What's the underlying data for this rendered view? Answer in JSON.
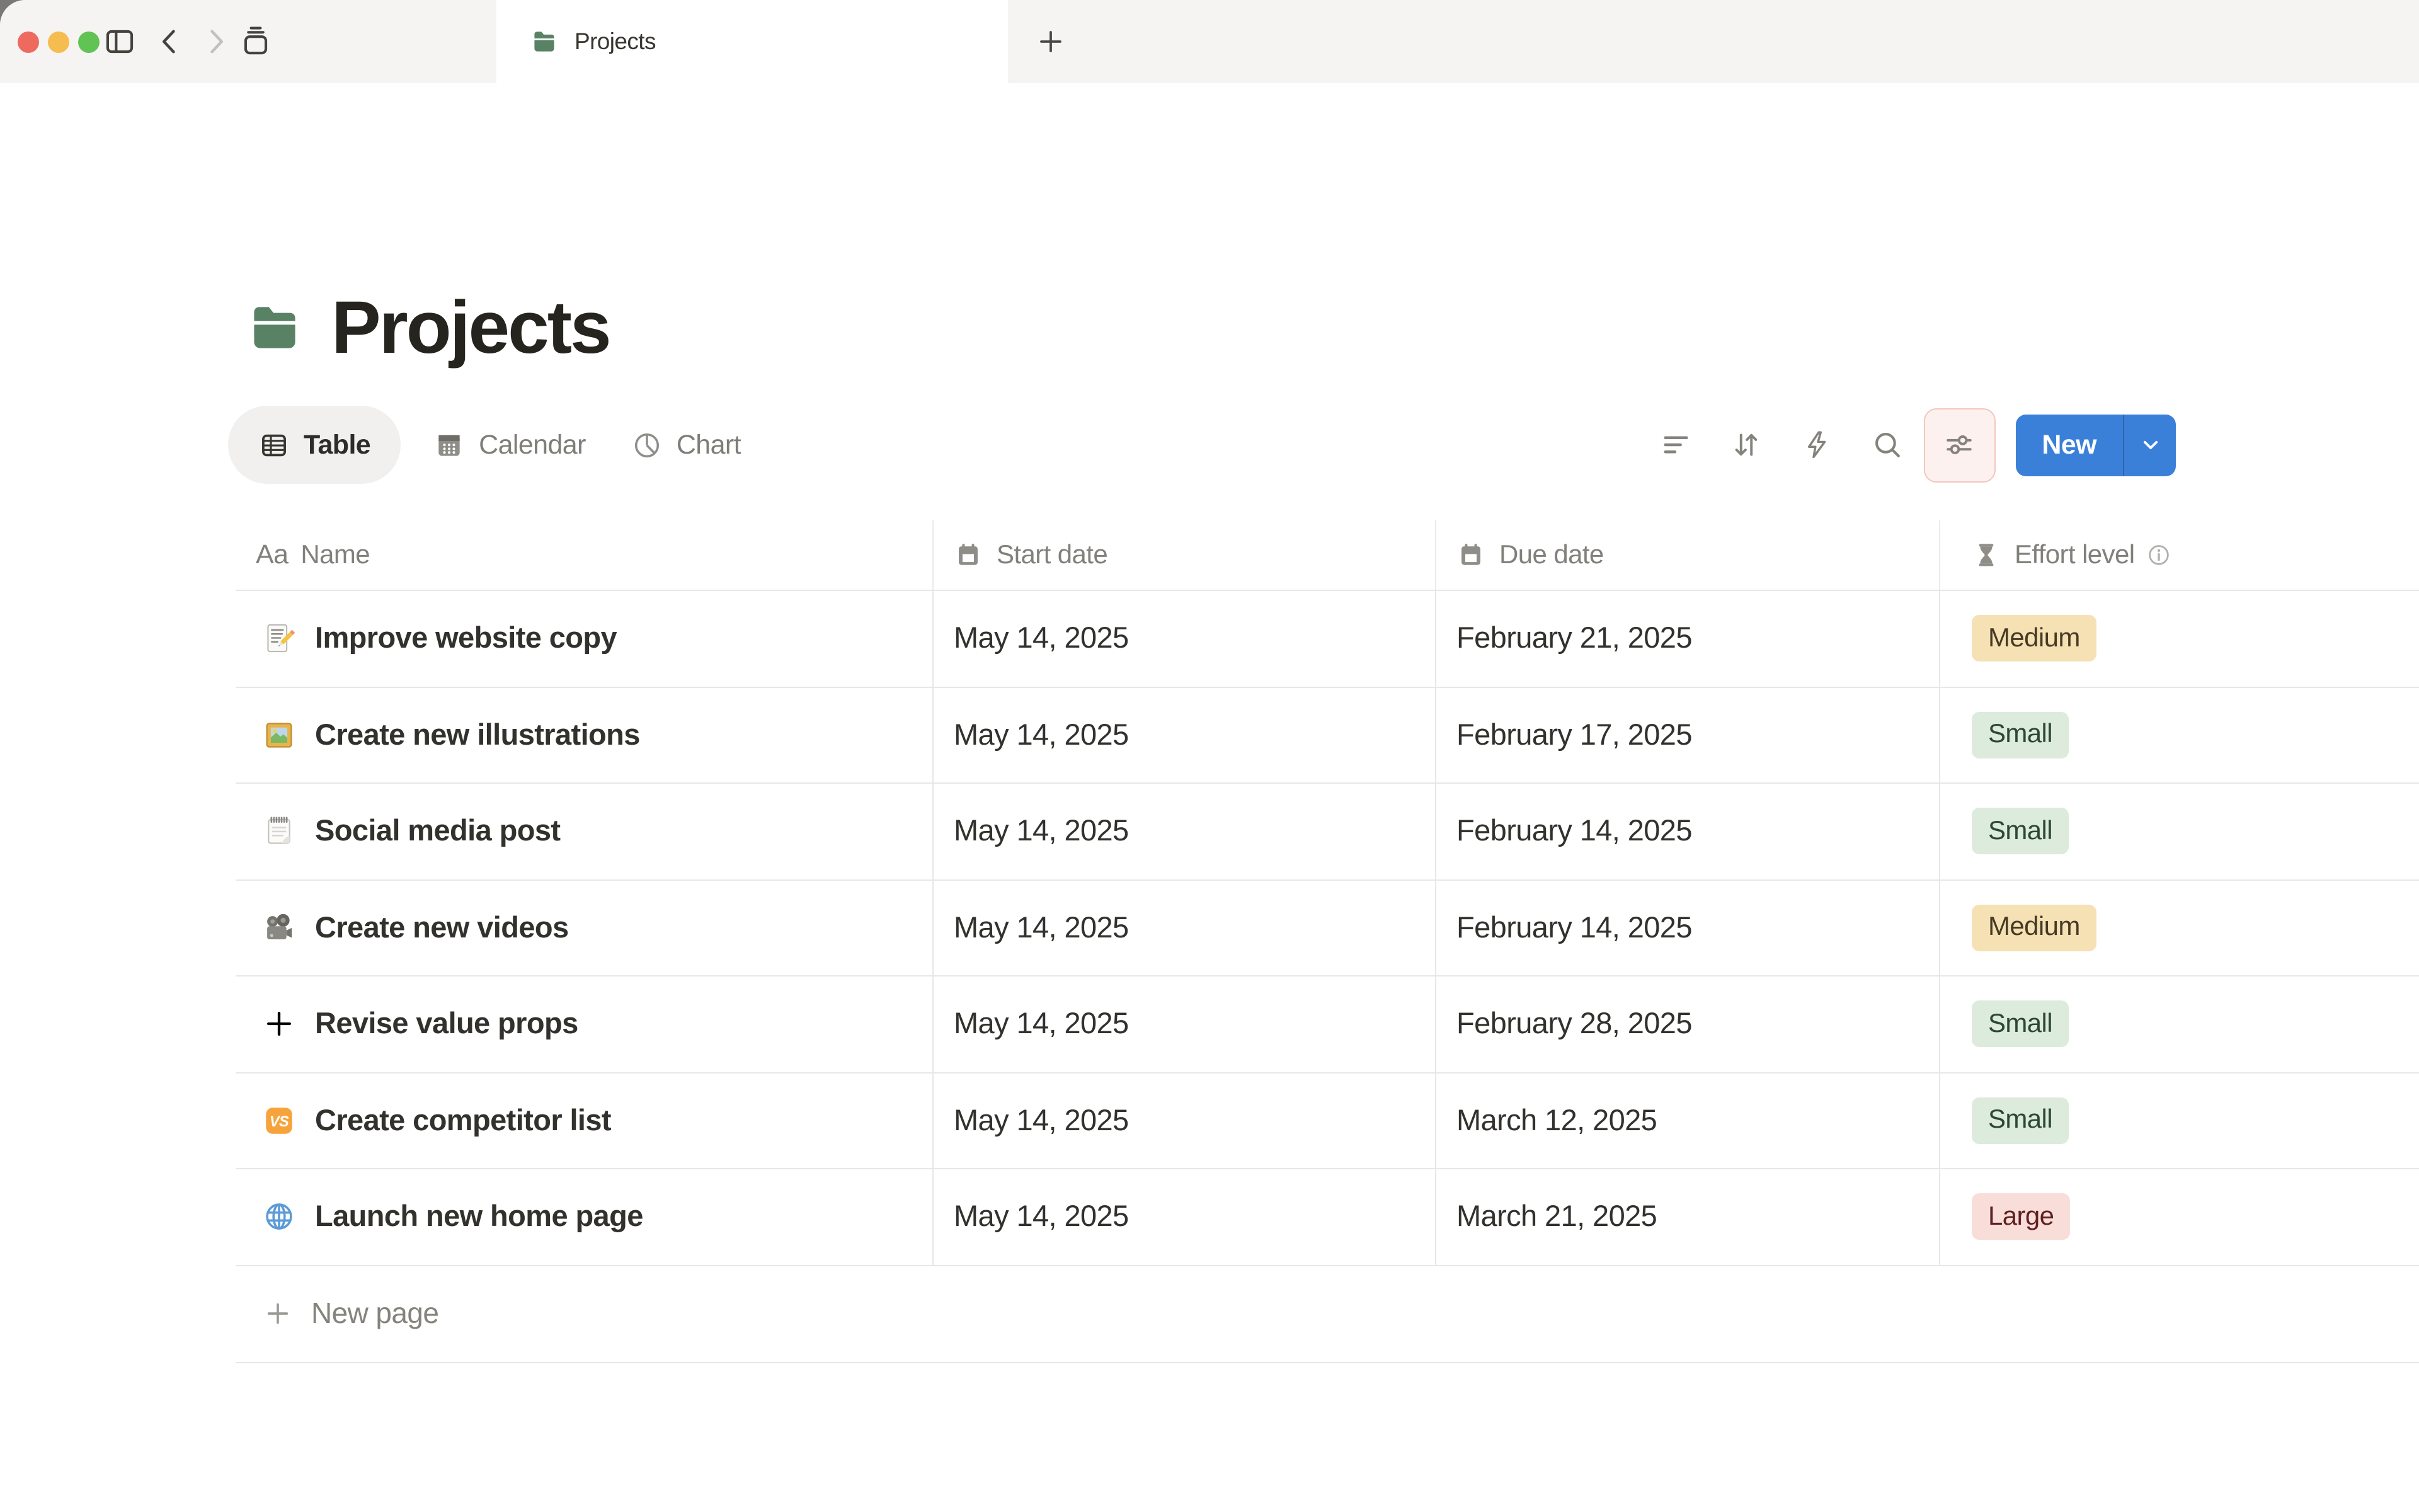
{
  "window": {
    "tab_title": "Projects"
  },
  "page": {
    "title": "Projects",
    "icon": "folder"
  },
  "views": [
    {
      "label": "Table",
      "icon": "table",
      "active": true
    },
    {
      "label": "Calendar",
      "icon": "calendar",
      "active": false
    },
    {
      "label": "Chart",
      "icon": "chart",
      "active": false
    }
  ],
  "toolbar": {
    "new_label": "New",
    "icons": [
      "filter",
      "sort",
      "automations",
      "search",
      "view-settings"
    ]
  },
  "table": {
    "columns": [
      {
        "label": "Name",
        "icon": "text",
        "icon_glyph": "Aa"
      },
      {
        "label": "Start date",
        "icon": "calendar"
      },
      {
        "label": "Due date",
        "icon": "calendar"
      },
      {
        "label": "Effort level",
        "icon": "hourglass",
        "info": true
      }
    ],
    "rows": [
      {
        "icon": "memo",
        "name": "Improve website copy",
        "start_date": "May 14, 2025",
        "due_date": "February 21, 2025",
        "effort": {
          "label": "Medium",
          "color": "yellow"
        }
      },
      {
        "icon": "frame",
        "name": "Create new illustrations",
        "start_date": "May 14, 2025",
        "due_date": "February 17, 2025",
        "effort": {
          "label": "Small",
          "color": "green"
        }
      },
      {
        "icon": "notepad",
        "name": "Social media post",
        "start_date": "May 14, 2025",
        "due_date": "February 14, 2025",
        "effort": {
          "label": "Small",
          "color": "green"
        }
      },
      {
        "icon": "camera",
        "name": "Create new videos",
        "start_date": "May 14, 2025",
        "due_date": "February 14, 2025",
        "effort": {
          "label": "Medium",
          "color": "yellow"
        }
      },
      {
        "icon": "plus",
        "name": "Revise value props",
        "start_date": "May 14, 2025",
        "due_date": "February 28, 2025",
        "effort": {
          "label": "Small",
          "color": "green"
        }
      },
      {
        "icon": "vs",
        "name": "Create competitor list",
        "start_date": "May 14, 2025",
        "due_date": "March 12, 2025",
        "effort": {
          "label": "Small",
          "color": "green"
        }
      },
      {
        "icon": "globe",
        "name": "Launch new home page",
        "start_date": "May 14, 2025",
        "due_date": "March 21, 2025",
        "effort": {
          "label": "Large",
          "color": "red"
        }
      }
    ],
    "new_page_label": "New page"
  },
  "colors": {
    "accent_blue": "#3a80d9",
    "folder_green": "#598264",
    "tabbar_bg": "#f5f4f2",
    "pill_bg": "#f1f0ee",
    "badge_yellow_bg": "#f6e1b5",
    "badge_yellow_text": "#453a24",
    "badge_green_bg": "#dcebdc",
    "badge_green_text": "#2c4835",
    "badge_red_bg": "#f9ddd9",
    "badge_red_text": "#5f2120",
    "settings_btn_bg": "#fdf1ef",
    "settings_btn_border": "#f2c6c1",
    "traffic_red": "#ee6a5f",
    "traffic_yellow": "#f5bd4f",
    "traffic_green": "#61c354"
  }
}
